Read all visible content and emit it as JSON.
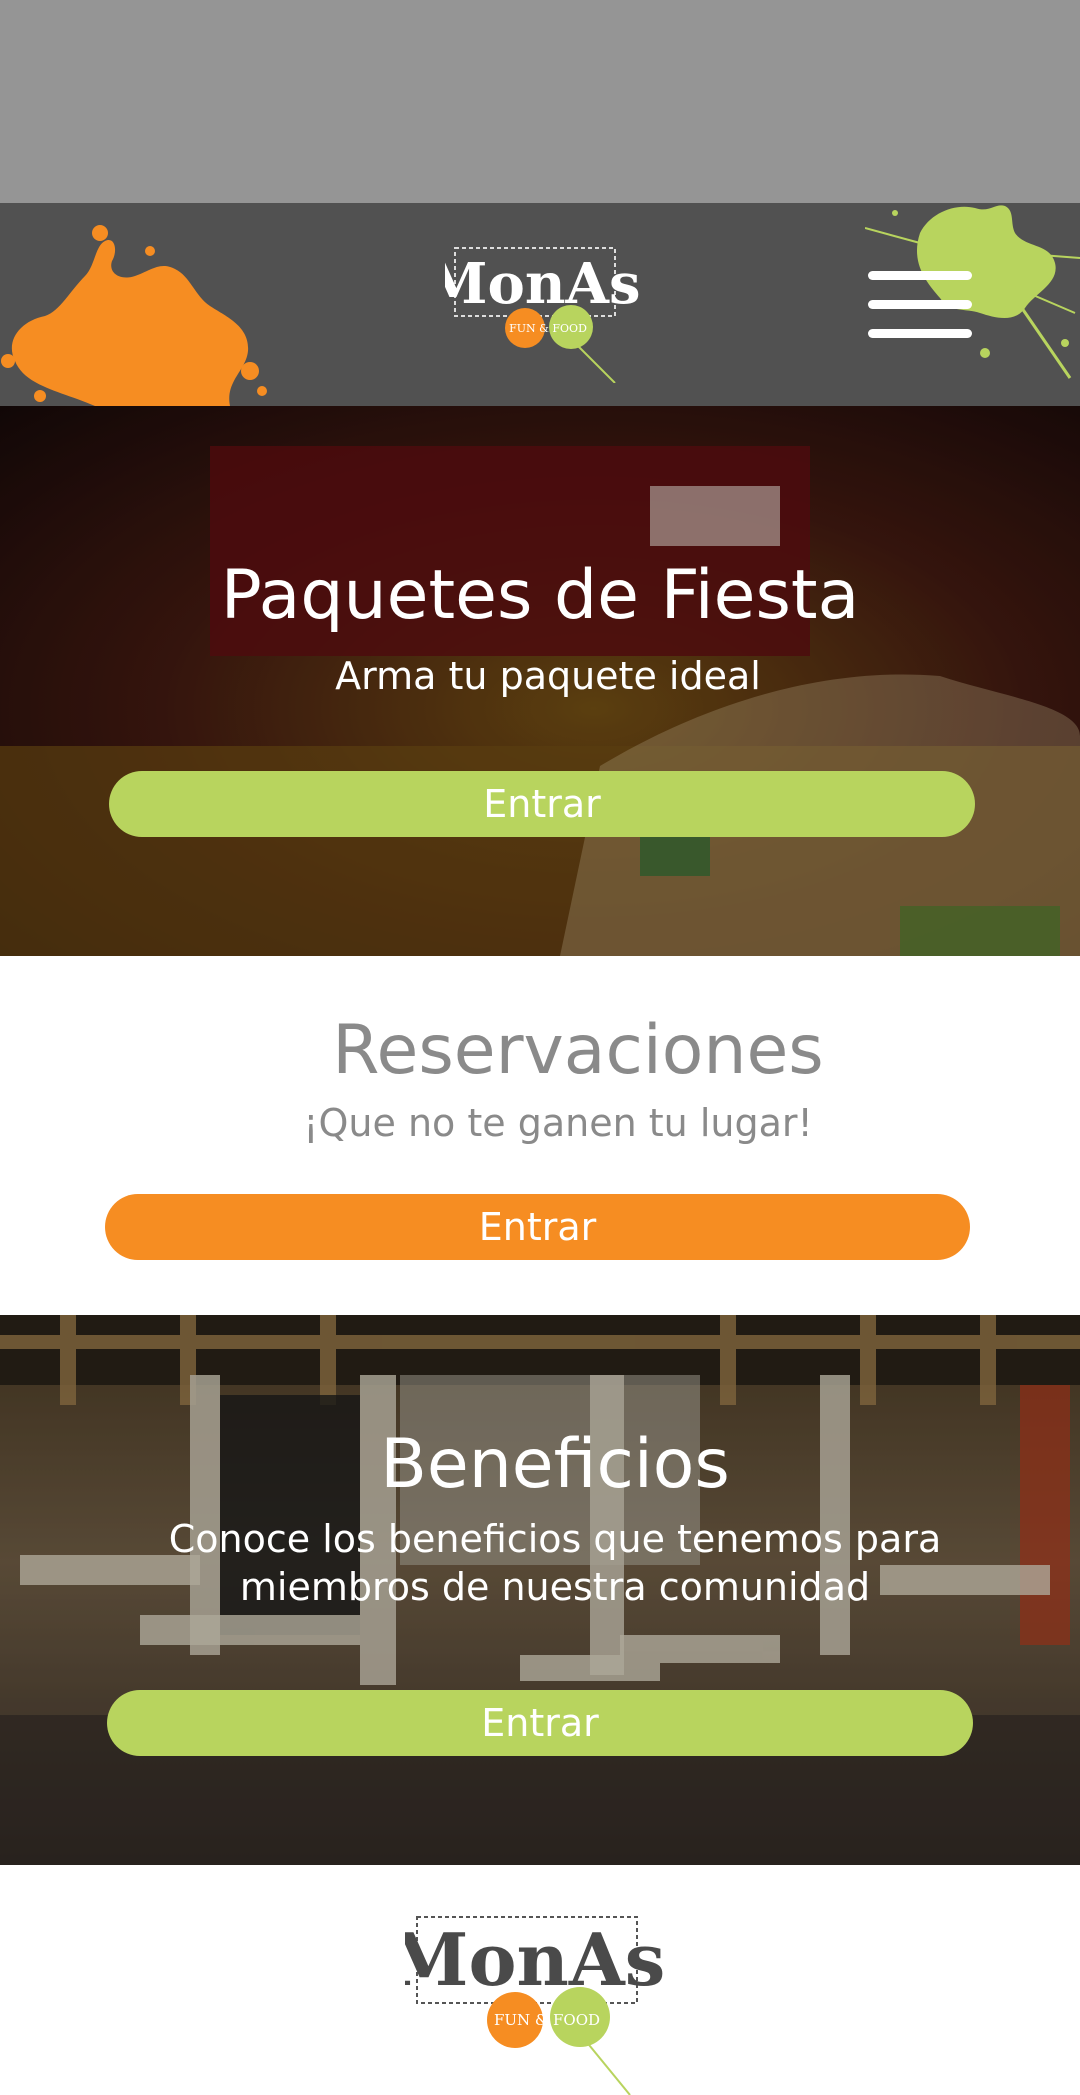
{
  "header": {
    "logo_text": "MonAs",
    "logo_tagline": "FUN & FOOD",
    "menu_icon": "hamburger-menu-icon",
    "colors": {
      "bar": "#515151",
      "top_strip": "#959595",
      "orange": "#f68d22",
      "green": "#b8d45e"
    }
  },
  "sections": [
    {
      "title": "Paquetes de Fiesta",
      "subtitle": "Arma tu paquete ideal",
      "button": "Entrar",
      "button_color": "#b8d45e"
    },
    {
      "title": "Reservaciones",
      "subtitle": "¡Que no te ganen tu lugar!",
      "button": "Entrar",
      "button_color": "#f68d22"
    },
    {
      "title": "Beneficios",
      "subtitle_line1": "Conoce los beneficios que tenemos para",
      "subtitle_line2": "miembros de nuestra comunidad",
      "button": "Entrar",
      "button_color": "#b8d45e"
    }
  ],
  "footer": {
    "logo_text": "MonAs",
    "logo_tagline": "FUN & FOOD"
  }
}
